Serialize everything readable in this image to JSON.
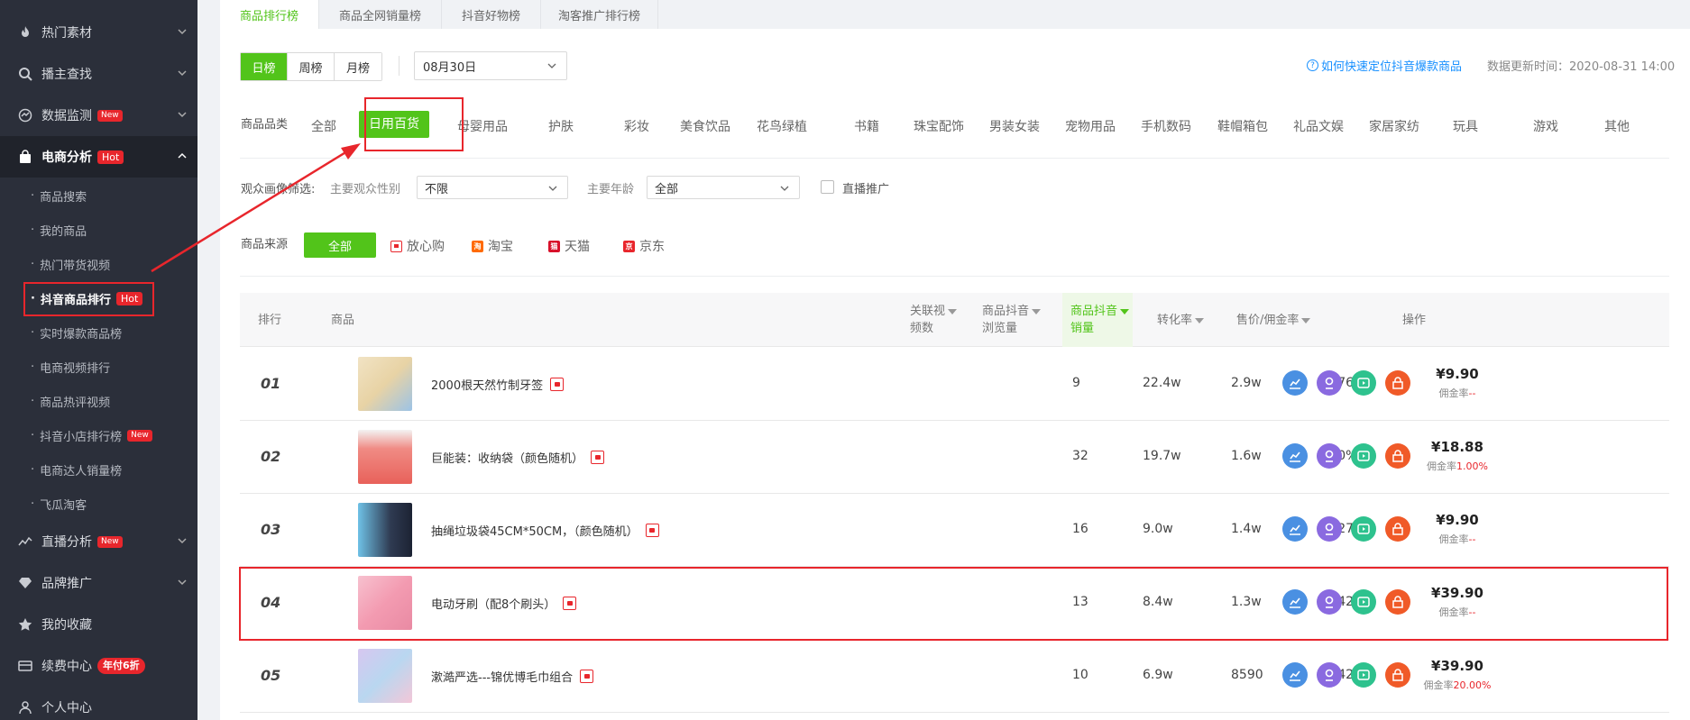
{
  "sidebar": {
    "items": [
      {
        "label": "热门素材",
        "icon": "fire-icon"
      },
      {
        "label": "播主查找",
        "icon": "search-icon"
      },
      {
        "label": "数据监测",
        "icon": "monitor-icon",
        "badge": "New"
      },
      {
        "label": "电商分析",
        "icon": "shopping-bag-icon",
        "badge": "Hot"
      },
      {
        "label": "直播分析",
        "icon": "trend-icon",
        "badge": "New"
      },
      {
        "label": "品牌推广",
        "icon": "diamond-icon"
      },
      {
        "label": "我的收藏",
        "icon": "star-icon"
      },
      {
        "label": "续费中心",
        "icon": "card-icon",
        "badge": "年付6折"
      },
      {
        "label": "个人中心",
        "icon": "user-icon"
      }
    ],
    "sub_items": [
      {
        "label": "商品搜索"
      },
      {
        "label": "我的商品"
      },
      {
        "label": "热门带货视频"
      },
      {
        "label": "抖音商品排行",
        "badge": "Hot"
      },
      {
        "label": "实时爆款商品榜"
      },
      {
        "label": "电商视频排行"
      },
      {
        "label": "商品热评视频"
      },
      {
        "label": "抖音小店排行榜",
        "badge": "New"
      },
      {
        "label": "电商达人销量榜"
      },
      {
        "label": "飞瓜淘客"
      }
    ]
  },
  "tabs": [
    "商品排行榜",
    "商品全网销量榜",
    "抖音好物榜",
    "淘客推广排行榜"
  ],
  "period": [
    "日榜",
    "周榜",
    "月榜"
  ],
  "date_select": "08月30日",
  "help_link": "如何快速定位抖音爆款商品",
  "update_time": "数据更新时间：2020-08-31 14:00",
  "category_label": "商品品类",
  "categories": [
    "全部",
    "日用百货",
    "母婴用品",
    "护肤",
    "彩妆",
    "美食饮品",
    "花鸟绿植",
    "书籍",
    "珠宝配饰",
    "男装女装",
    "宠物用品",
    "手机数码",
    "鞋帽箱包",
    "礼品文娱",
    "家居家纺",
    "玩具",
    "游戏",
    "其他"
  ],
  "audience": {
    "label": "观众画像筛选:",
    "gender_label": "主要观众性别",
    "gender_value": "不限",
    "age_label": "主要年龄",
    "age_value": "全部",
    "live_label": "直播推广"
  },
  "source": {
    "label": "商品来源",
    "all": "全部",
    "items": [
      "放心购",
      "淘宝",
      "天猫",
      "京东"
    ]
  },
  "table": {
    "headers": {
      "rank": "排行",
      "product": "商品",
      "videos_1": "关联视",
      "videos_2": "频数",
      "views_1": "商品抖音",
      "views_2": "浏览量",
      "sales_1": "商品抖音",
      "sales_2": "销量",
      "conv": "转化率",
      "price": "售价/佣金率",
      "ops": "操作"
    },
    "rate_prefix": "佣金率",
    "rows": [
      {
        "rank": "01",
        "name": "2000根天然竹制牙签",
        "videos": "9",
        "views": "22.4w",
        "sales": "2.9w",
        "conv": "12.76%",
        "price": "¥9.90",
        "rate": "--"
      },
      {
        "rank": "02",
        "name": "巨能装：收纳袋（颜色随机）",
        "videos": "32",
        "views": "19.7w",
        "sales": "1.6w",
        "conv": "7.90%",
        "price": "¥18.88",
        "rate": "1.00%"
      },
      {
        "rank": "03",
        "name": "抽绳垃圾袋45CM*50CM，（颜色随机）",
        "videos": "16",
        "views": "9.0w",
        "sales": "1.4w",
        "conv": "15.27%",
        "price": "¥9.90",
        "rate": "--"
      },
      {
        "rank": "04",
        "name": "电动牙刷（配8个刷头）",
        "videos": "13",
        "views": "8.4w",
        "sales": "1.3w",
        "conv": "15.42%",
        "price": "¥39.90",
        "rate": "--"
      },
      {
        "rank": "05",
        "name": "漱澔严选---锦优博毛巾组合",
        "videos": "10",
        "views": "6.9w",
        "sales": "8590",
        "conv": "12.42%",
        "price": "¥39.90",
        "rate": "20.00%"
      }
    ]
  },
  "colors": {
    "accent": "#52c41a",
    "sidebar": "#2b2f3a",
    "alert": "#e8262c",
    "link": "#1890ff"
  }
}
